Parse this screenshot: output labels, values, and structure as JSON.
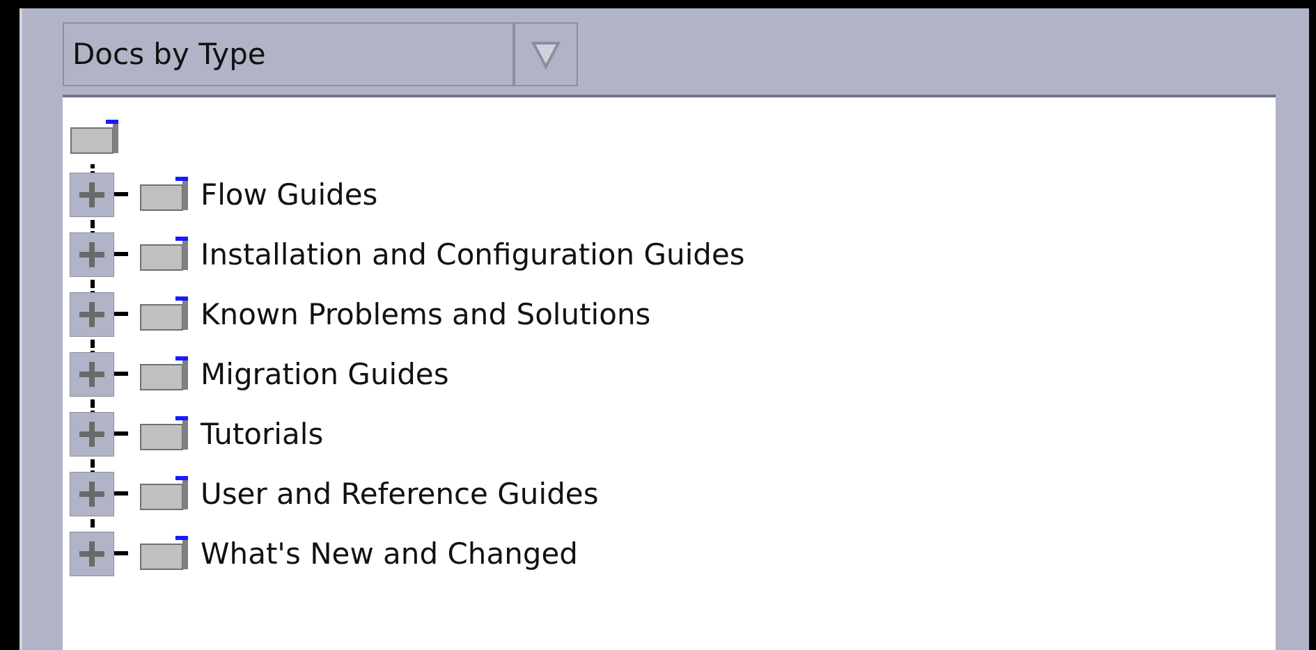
{
  "view_selector": {
    "value": "Docs by Type"
  },
  "tree": {
    "root": {
      "children": [
        {
          "label": "Flow Guides",
          "expanded": false
        },
        {
          "label": "Installation and Configuration Guides",
          "expanded": false
        },
        {
          "label": "Known Problems and Solutions",
          "expanded": false
        },
        {
          "label": "Migration Guides",
          "expanded": false
        },
        {
          "label": "Tutorials",
          "expanded": false
        },
        {
          "label": "User and Reference Guides",
          "expanded": false
        },
        {
          "label": "What's New and Changed",
          "expanded": false
        }
      ]
    }
  }
}
